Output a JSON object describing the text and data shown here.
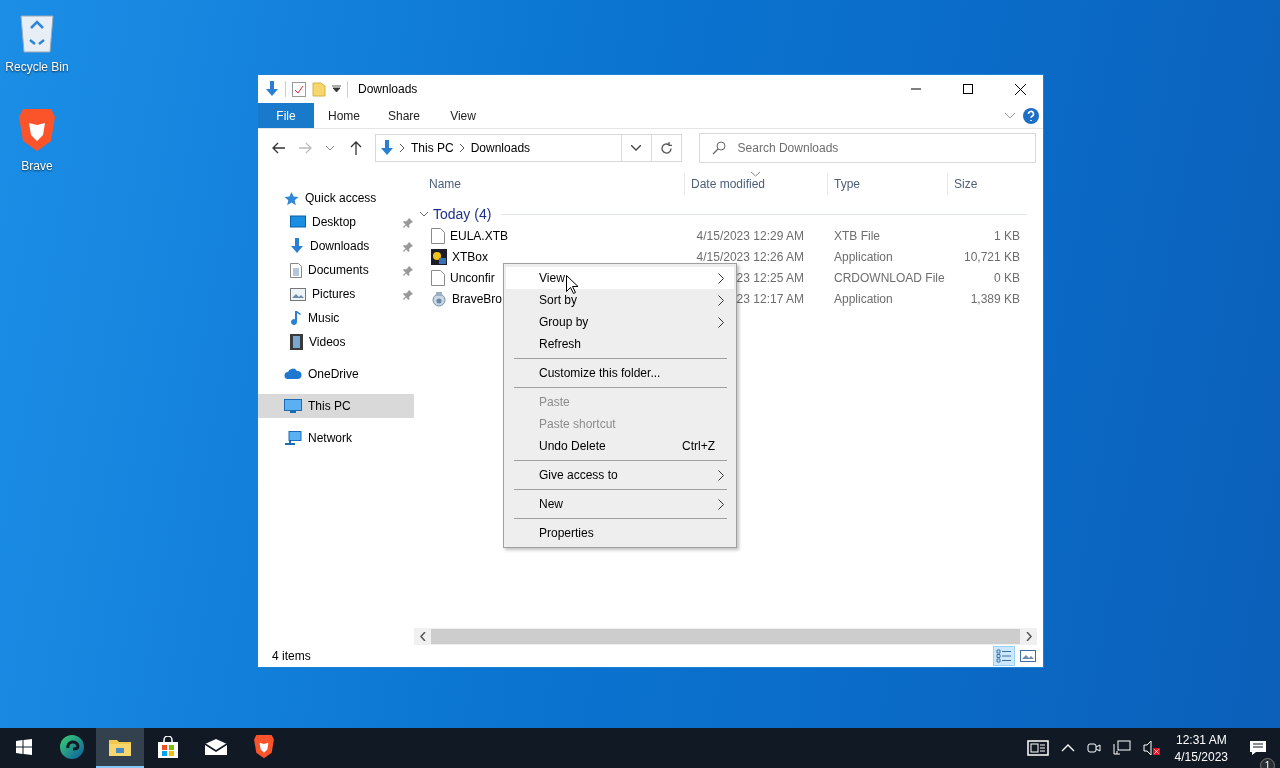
{
  "desktop_icons": [
    {
      "kind": "recycle",
      "label": "Recycle Bin"
    },
    {
      "kind": "brave",
      "label": "Brave"
    }
  ],
  "window": {
    "title": "Downloads",
    "ribbon_tabs": [
      {
        "kind": "file",
        "label": "File"
      },
      {
        "kind": "tab",
        "label": "Home"
      },
      {
        "kind": "tab",
        "label": "Share"
      },
      {
        "kind": "tab",
        "label": "View"
      }
    ],
    "address": {
      "segments": [
        "This PC",
        "Downloads"
      ]
    },
    "search": {
      "placeholder": "Search Downloads"
    },
    "nav": [
      {
        "kind": "star",
        "label": "Quick access",
        "pinned": false,
        "selected": false,
        "children": [
          {
            "kind": "desktop",
            "label": "Desktop",
            "pinned": true,
            "selected": false
          },
          {
            "kind": "download",
            "label": "Downloads",
            "pinned": true,
            "selected": false
          },
          {
            "kind": "document",
            "label": "Documents",
            "pinned": true,
            "selected": false
          },
          {
            "kind": "pictures",
            "label": "Pictures",
            "pinned": true,
            "selected": false
          },
          {
            "kind": "music",
            "label": "Music",
            "pinned": false,
            "selected": false
          },
          {
            "kind": "videos",
            "label": "Videos",
            "pinned": false,
            "selected": false
          }
        ]
      },
      {
        "kind": "onedrive",
        "label": "OneDrive",
        "pinned": false,
        "selected": false
      },
      {
        "kind": "pc",
        "label": "This PC",
        "pinned": false,
        "selected": true
      },
      {
        "kind": "network",
        "label": "Network",
        "pinned": false,
        "selected": false
      }
    ],
    "columns": [
      {
        "label": "Name",
        "sorted": false
      },
      {
        "label": "Date modified",
        "sorted": true
      },
      {
        "label": "Type",
        "sorted": false
      },
      {
        "label": "Size",
        "sorted": false
      }
    ],
    "group": {
      "label": "Today (4)",
      "expanded": true
    },
    "rows": [
      {
        "kind": "file",
        "name": "EULA.XTB",
        "date": "4/15/2023 12:29 AM",
        "type": "XTB File",
        "size": "1 KB"
      },
      {
        "kind": "app",
        "name": "XTBox",
        "date": "4/15/2023 12:26 AM",
        "type": "Application",
        "size": "10,721 KB"
      },
      {
        "kind": "file",
        "name": "Unconfir",
        "date": "23 12:25 AM",
        "type": "CRDOWNLOAD File",
        "size": "0 KB"
      },
      {
        "kind": "installer",
        "name": "BraveBro",
        "date": "23 12:17 AM",
        "type": "Application",
        "size": "1,389 KB"
      }
    ],
    "status_bar": {
      "text": "4 items",
      "view_buttons": [
        {
          "kind": "details",
          "selected": true
        },
        {
          "kind": "thumbnails",
          "selected": false
        }
      ]
    }
  },
  "context_menu": {
    "items": [
      {
        "kind": "item",
        "label": "View",
        "submenu": true,
        "disabled": false,
        "highlighted": true
      },
      {
        "kind": "item",
        "label": "Sort by",
        "submenu": true,
        "disabled": false,
        "highlighted": false
      },
      {
        "kind": "item",
        "label": "Group by",
        "submenu": true,
        "disabled": false,
        "highlighted": false
      },
      {
        "kind": "item",
        "label": "Refresh",
        "submenu": false,
        "disabled": false,
        "highlighted": false
      },
      {
        "kind": "separator"
      },
      {
        "kind": "item",
        "label": "Customize this folder...",
        "submenu": false,
        "disabled": false,
        "highlighted": false
      },
      {
        "kind": "separator"
      },
      {
        "kind": "item",
        "label": "Paste",
        "submenu": false,
        "disabled": true,
        "highlighted": false
      },
      {
        "kind": "item",
        "label": "Paste shortcut",
        "submenu": false,
        "disabled": true,
        "highlighted": false
      },
      {
        "kind": "item",
        "label": "Undo Delete",
        "shortcut": "Ctrl+Z",
        "submenu": false,
        "disabled": false,
        "highlighted": false
      },
      {
        "kind": "separator"
      },
      {
        "kind": "item",
        "label": "Give access to",
        "submenu": true,
        "disabled": false,
        "highlighted": false
      },
      {
        "kind": "separator"
      },
      {
        "kind": "item",
        "label": "New",
        "submenu": true,
        "disabled": false,
        "highlighted": false
      },
      {
        "kind": "separator"
      },
      {
        "kind": "item",
        "label": "Properties",
        "submenu": false,
        "disabled": false,
        "highlighted": false
      }
    ]
  },
  "taskbar": {
    "apps": [
      {
        "kind": "start",
        "active": false
      },
      {
        "kind": "edge",
        "active": false
      },
      {
        "kind": "explorer",
        "active": true
      },
      {
        "kind": "store",
        "active": false
      },
      {
        "kind": "mail",
        "active": false
      },
      {
        "kind": "brave",
        "active": false
      }
    ],
    "tray": [
      {
        "kind": "news"
      },
      {
        "kind": "chevron"
      },
      {
        "kind": "meet"
      },
      {
        "kind": "network"
      },
      {
        "kind": "volume-muted"
      }
    ],
    "clock": {
      "time": "12:31 AM",
      "date": "4/15/2023"
    },
    "notifications": {
      "badge": "1"
    }
  }
}
